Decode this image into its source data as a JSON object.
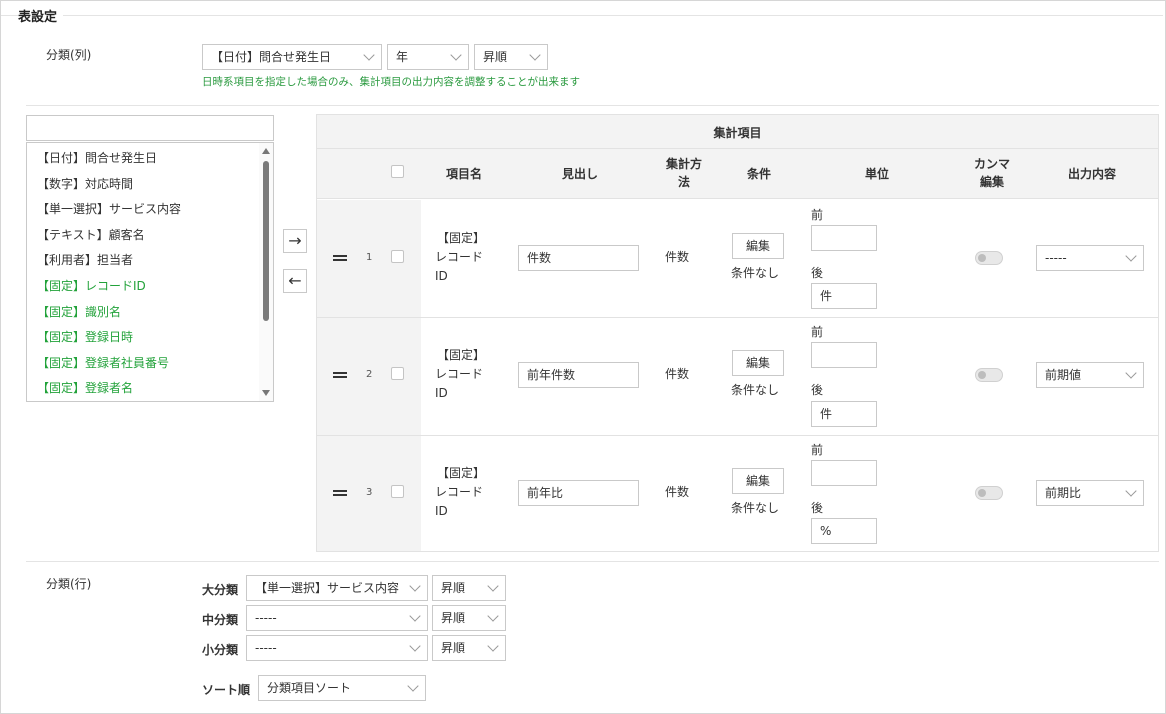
{
  "section_title": "表設定",
  "column_classification": {
    "label": "分類(列)",
    "field_select": "【日付】問合せ発生日",
    "unit_select": "年",
    "order_select": "昇順",
    "note": "日時系項目を指定した場合のみ、集計項目の出力内容を調整することが出来ます"
  },
  "field_list": {
    "search_value": "",
    "items": [
      {
        "label": "【日付】問合せ発生日"
      },
      {
        "label": "【数字】対応時間"
      },
      {
        "label": "【単一選択】サービス内容"
      },
      {
        "label": "【テキスト】顧客名"
      },
      {
        "label": "【利用者】担当者"
      },
      {
        "label": "【固定】レコードID"
      },
      {
        "label": "【固定】識別名"
      },
      {
        "label": "【固定】登録日時"
      },
      {
        "label": "【固定】登録者社員番号"
      },
      {
        "label": "【固定】登録者名"
      }
    ]
  },
  "transfer": {
    "add_icon": "arrow-right",
    "remove_icon": "arrow-left",
    "add_glyph": "→",
    "remove_glyph": "←"
  },
  "agg_table": {
    "title": "集計項目",
    "headers": {
      "item_name": "項目名",
      "heading": "見出し",
      "agg_method_line1": "集計方",
      "agg_method_line2": "法",
      "condition": "条件",
      "unit": "単位",
      "comma_line1": "カンマ",
      "comma_line2": "編集",
      "output": "出力内容"
    },
    "unit_before_label": "前",
    "unit_after_label": "後",
    "edit_label": "編集",
    "rows": [
      {
        "num": "1",
        "item_line1": "【固定】",
        "item_line2": "レコード",
        "item_line3": "ID",
        "heading": "件数",
        "method": "件数",
        "condition": "条件なし",
        "before": "",
        "after": "件",
        "output": "-----"
      },
      {
        "num": "2",
        "item_line1": "【固定】",
        "item_line2": "レコード",
        "item_line3": "ID",
        "heading": "前年件数",
        "method": "件数",
        "condition": "条件なし",
        "before": "",
        "after": "件",
        "output": "前期値"
      },
      {
        "num": "3",
        "item_line1": "【固定】",
        "item_line2": "レコード",
        "item_line3": "ID",
        "heading": "前年比",
        "method": "件数",
        "condition": "条件なし",
        "before": "",
        "after": "%",
        "output": "前期比"
      }
    ]
  },
  "row_classification": {
    "label": "分類(行)",
    "major_label": "大分類",
    "major_select": "【単一選択】サービス内容",
    "major_order": "昇順",
    "middle_label": "中分類",
    "middle_select": "-----",
    "middle_order": "昇順",
    "minor_label": "小分類",
    "minor_select": "-----",
    "minor_order": "昇順",
    "sort_label": "ソート順",
    "sort_select": "分類項目ソート"
  },
  "colors": {
    "accent_green": "#22a23a",
    "note_green": "#2a9a3f",
    "header_bg": "#f3f3f3"
  }
}
